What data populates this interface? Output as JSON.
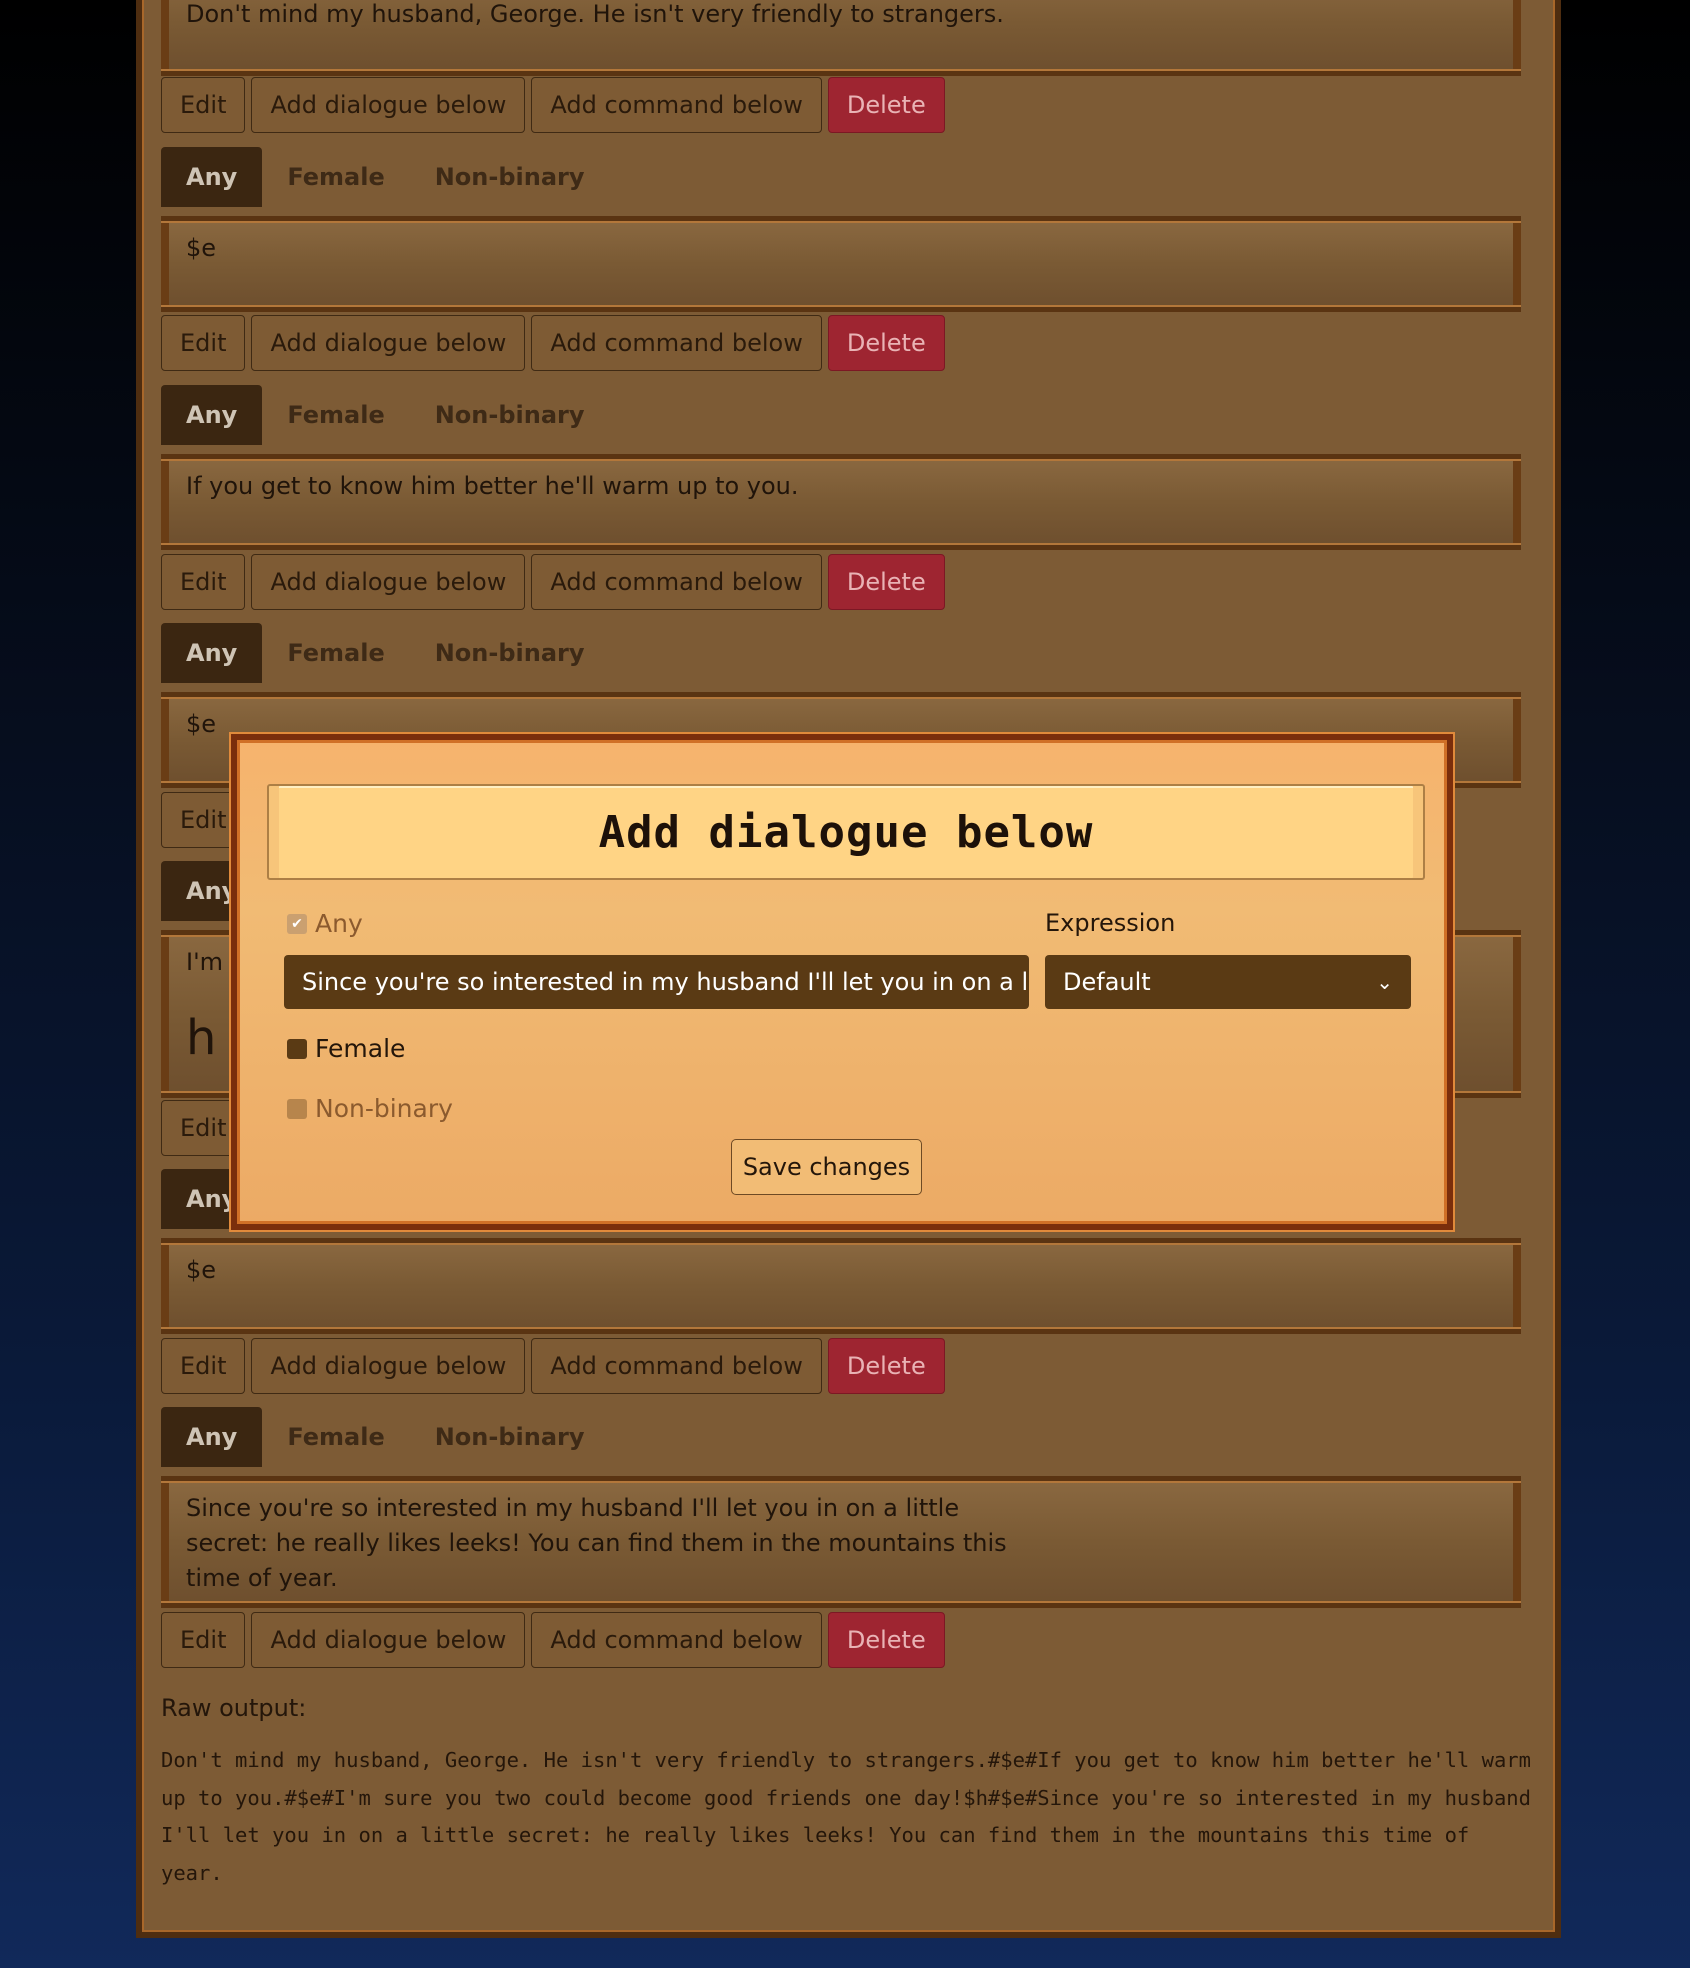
{
  "buttons": {
    "edit": "Edit",
    "add_dialogue": "Add dialogue below",
    "add_command": "Add command below",
    "delete": "Delete"
  },
  "tabs": [
    "Any",
    "Female",
    "Non-binary"
  ],
  "entries": [
    "Don't mind my husband, George. He isn't very friendly to strangers.",
    "$e",
    "If you get to know him better he'll warm up to you.",
    "$e",
    "I'm sure you two could become good friends one day!",
    "h",
    "$e",
    "Since you're so interested in my husband I'll let you in on a little secret: he really likes leeks! You can find them in the mountains this time of year."
  ],
  "partial": {
    "im": "I'm",
    "h": "h"
  },
  "raw": {
    "label": "Raw output:",
    "text": "Don't mind my husband, George. He isn't very friendly to strangers.#$e#If you get to know him better he'll warm up to you.#$e#I'm sure you two could become good friends one day!$h#$e#Since you're so interested in my husband I'll let you in on a little secret: he really likes leeks! You can find them in the mountains this time of year."
  },
  "modal": {
    "title": "Add dialogue below",
    "any_label": "Any",
    "input_value": "Since you're so interested in my husband I'll let you in on a little secret: he really likes leeks!",
    "female_label": "Female",
    "nonbinary_label": "Non-binary",
    "expression_label": "Expression",
    "expression_value": "Default",
    "save_label": "Save changes"
  }
}
